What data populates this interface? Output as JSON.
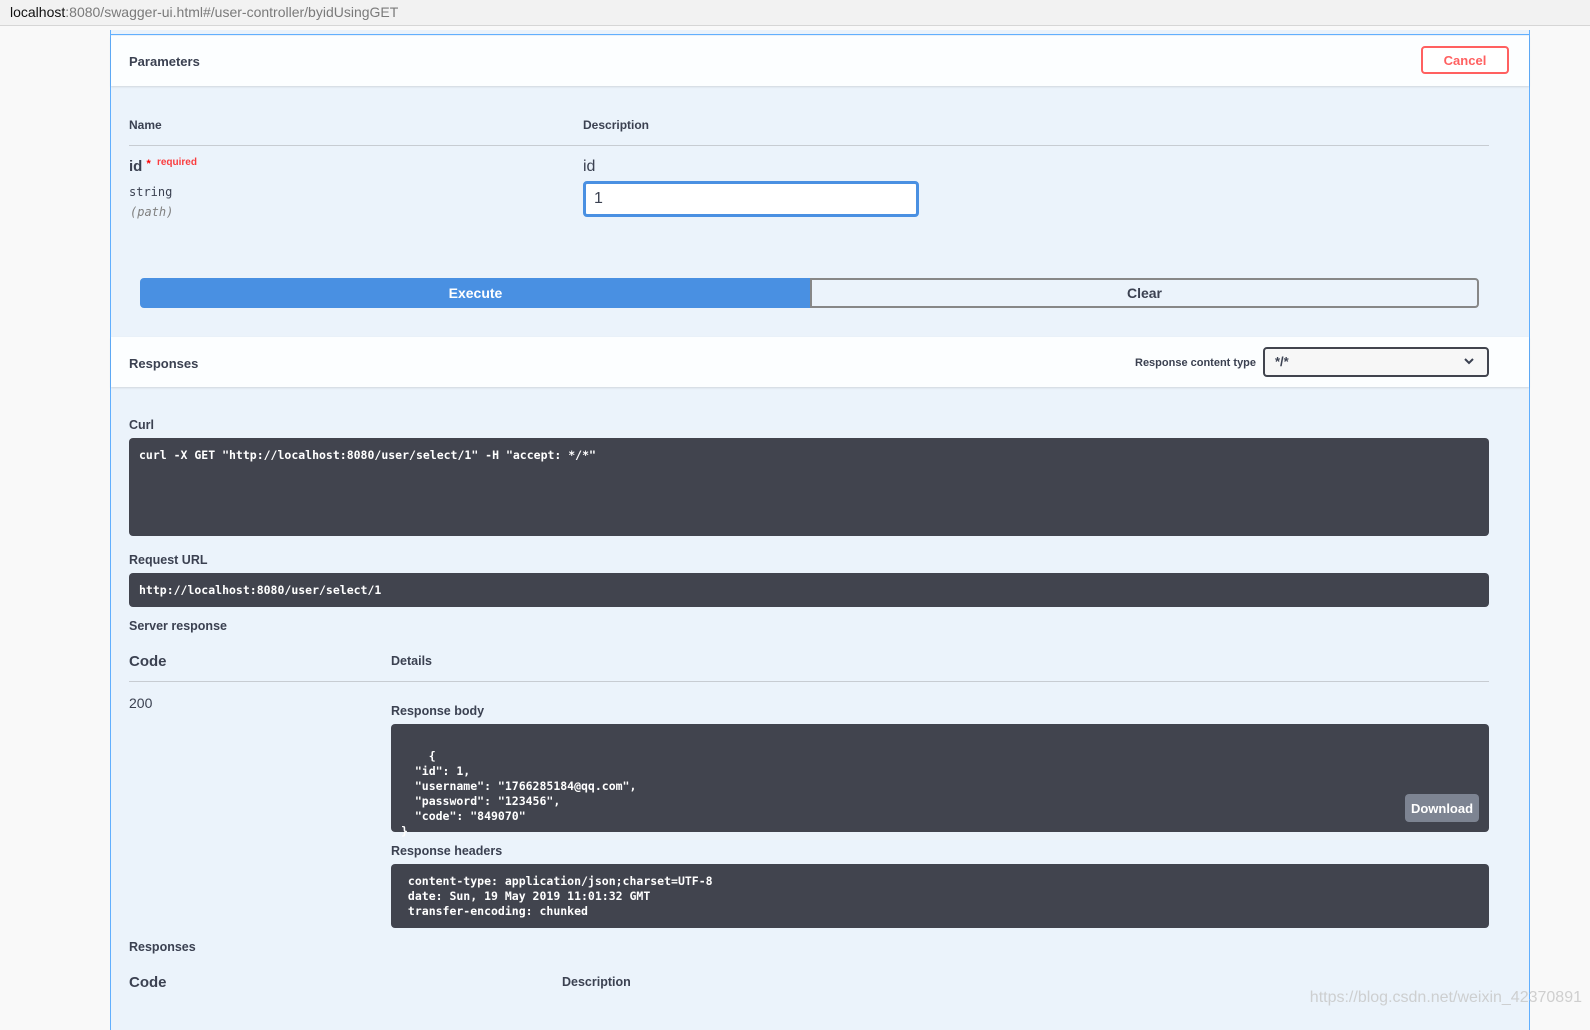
{
  "address_bar": {
    "host": "localhost",
    "path": ":8080/swagger-ui.html#/user-controller/byidUsingGET"
  },
  "parameters": {
    "title": "Parameters",
    "cancel_label": "Cancel",
    "col_name": "Name",
    "col_description": "Description",
    "param": {
      "name": "id",
      "required_star": "*",
      "required_label": "required",
      "type": "string",
      "in": "(path)",
      "description": "id",
      "value": "1"
    }
  },
  "actions": {
    "execute_label": "Execute",
    "clear_label": "Clear"
  },
  "responses_header": {
    "title": "Responses",
    "content_type_label": "Response content type",
    "content_type_value": "*/*"
  },
  "curl": {
    "label": "Curl",
    "command": "curl -X GET \"http://localhost:8080/user/select/1\" -H \"accept: */*\""
  },
  "request_url": {
    "label": "Request URL",
    "value": "http://localhost:8080/user/select/1"
  },
  "server_response": {
    "label": "Server response",
    "col_code": "Code",
    "col_details": "Details",
    "code": "200",
    "body_label": "Response body",
    "body": "{\n  \"id\": 1,\n  \"username\": \"1766285184@qq.com\",\n  \"password\": \"123456\",\n  \"code\": \"849070\"\n}",
    "download_label": "Download",
    "headers_label": "Response headers",
    "headers": " content-type: application/json;charset=UTF-8\n date: Sun, 19 May 2019 11:01:32 GMT\n transfer-encoding: chunked"
  },
  "responses_list": {
    "title": "Responses",
    "col_code": "Code",
    "col_description": "Description"
  },
  "watermark": "https://blog.csdn.net/weixin_42370891"
}
